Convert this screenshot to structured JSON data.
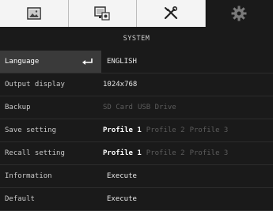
{
  "tabs": [
    {
      "name": "display-tab",
      "icon": "image-icon"
    },
    {
      "name": "network-tab",
      "icon": "network-settings-icon"
    },
    {
      "name": "tools-tab",
      "icon": "tools-icon"
    },
    {
      "name": "system-tab",
      "icon": "gear-icon",
      "active": true
    }
  ],
  "section_title": "SYSTEM",
  "rows": {
    "language": {
      "label": "Language",
      "value": "ENGLISH"
    },
    "output": {
      "label": "Output display",
      "value": "1024x768"
    },
    "backup": {
      "label": "Backup",
      "opt1": "SD Card",
      "opt2": "USB Drive"
    },
    "save": {
      "label": "Save setting",
      "p1": "Profile 1",
      "p2": "Profile 2",
      "p3": "Profile 3"
    },
    "recall": {
      "label": "Recall setting",
      "p1": "Profile 1",
      "p2": "Profile 2",
      "p3": "Profile 3"
    },
    "information": {
      "label": "Information",
      "value": "Execute"
    },
    "default": {
      "label": "Default",
      "value": "Execute"
    }
  },
  "colors": {
    "background": "#1a1a1a",
    "tab_bg": "#f4f4f4",
    "selected_row": "#3a3a3a",
    "dim_text": "#5c5c5c"
  }
}
